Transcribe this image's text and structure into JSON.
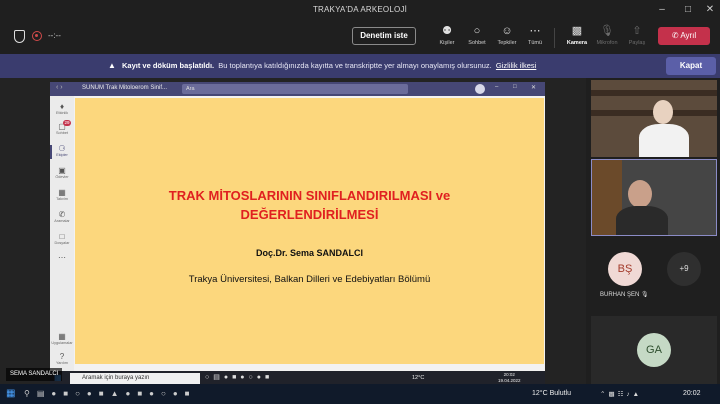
{
  "window": {
    "title": "TRAKYA'DA ARKEOLOJİ"
  },
  "toolbar": {
    "timer": "--:--",
    "inspect_button": "Denetim iste",
    "people": "Kişiler",
    "chat": "Sohbet",
    "reactions": "Tepkiler",
    "more": "Tümü",
    "camera": "Kamera",
    "mic": "Mikrofon",
    "share": "Paylaş",
    "leave": "Ayrıl"
  },
  "banner": {
    "bold": "Kayıt ve döküm başlatıldı.",
    "text": "Bu toplantıya katıldığınızda kayıtta ve transkriptte yer almayı onaylamış olursunuz.",
    "link": "Gizlilik ilkesi",
    "close": "Kapat"
  },
  "shared_screen": {
    "teams_title": "SUNUM Trak Mitoloerom Sinif...",
    "search_placeholder": "Ara",
    "rail": [
      {
        "icon": "bell-icon",
        "label": "Etkinlik"
      },
      {
        "icon": "chat-icon",
        "label": "Sohbet",
        "badge": "29"
      },
      {
        "icon": "teams-icon",
        "label": "Ekipler"
      },
      {
        "icon": "tasks-icon",
        "label": "Ödevler"
      },
      {
        "icon": "calendar-icon",
        "label": "Takvim"
      },
      {
        "icon": "calls-icon",
        "label": "Aramalar"
      },
      {
        "icon": "files-icon",
        "label": "Dosyalar"
      }
    ],
    "rail_bottom": [
      {
        "icon": "apps-icon",
        "label": "Uygulamalar"
      },
      {
        "icon": "help-icon",
        "label": "Yardım"
      }
    ],
    "slide": {
      "title_line1": "TRAK MİTOSLARININ SINIFLANDIRILMASI ve",
      "title_line2": "DEĞERLENDİRİLMESİ",
      "author": "Doç.Dr. Sema SANDALCI",
      "institution": "Trakya Üniversitesi, Balkan Dilleri ve Edebiyatları Bölümü"
    },
    "inner_taskbar": {
      "search": "Aramak için buraya yazın",
      "temp": "12°C",
      "time": "20:02",
      "date": "19.04.2022"
    },
    "presenter_label": "SEMA SANDALCI"
  },
  "participants": {
    "bs_initials": "BŞ",
    "bs_name": "BURHAN ŞEN",
    "more_count": "+9",
    "ga_initials": "GA"
  },
  "taskbar": {
    "weather": "12°C  Bulutlu",
    "time": "20:02"
  }
}
